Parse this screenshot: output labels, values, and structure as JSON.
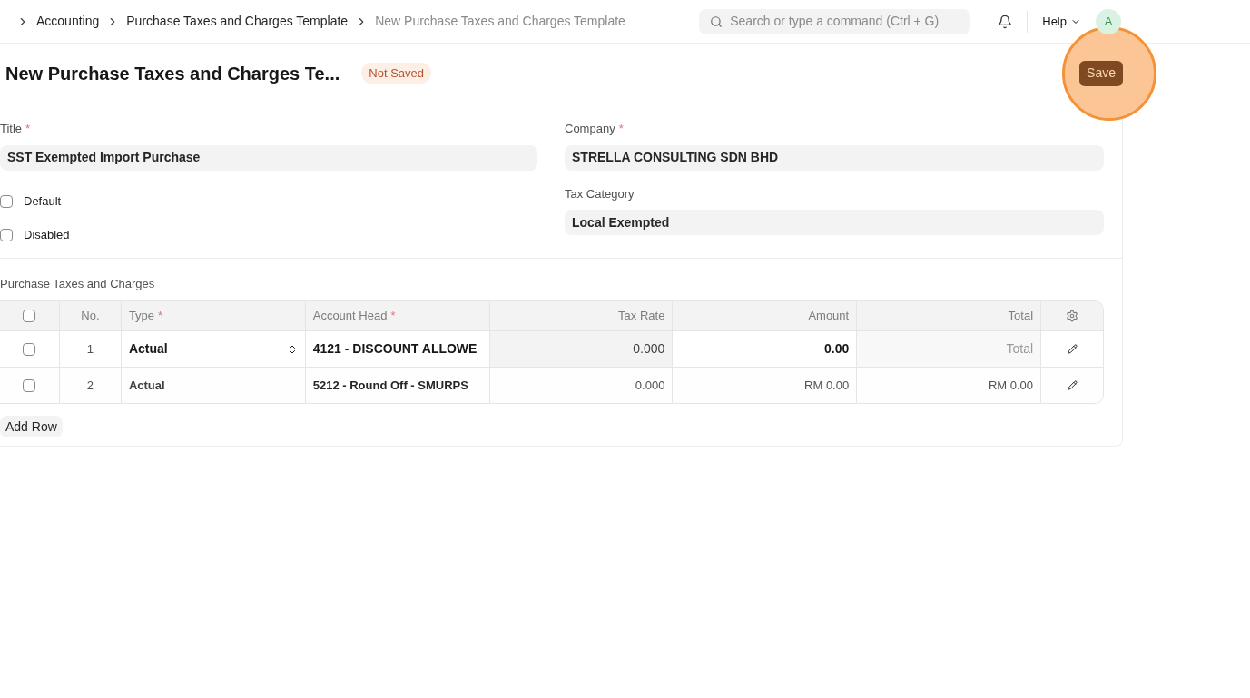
{
  "breadcrumbs": [
    {
      "label": "Accounting",
      "current": false
    },
    {
      "label": "Purchase Taxes and Charges Template",
      "current": false
    },
    {
      "label": "New Purchase Taxes and Charges Template",
      "current": true
    }
  ],
  "search": {
    "placeholder": "Search or type a command (Ctrl + G)"
  },
  "help": "Help",
  "avatar": "A",
  "page": {
    "title": "New Purchase Taxes and Charges Te...",
    "status": "Not Saved",
    "save": "Save",
    "highlight_save": true
  },
  "fields_left": [
    {
      "kind": "text",
      "label": "Title",
      "required_mark": "*",
      "value": "SST Exempted Import Purchase"
    },
    {
      "kind": "checkbox",
      "label": "Default",
      "checked": false
    },
    {
      "kind": "checkbox",
      "label": "Disabled",
      "checked": false
    }
  ],
  "fields_right": [
    {
      "kind": "text",
      "label": "Company",
      "required_mark": "*",
      "value": "STRELLA CONSULTING SDN BHD"
    },
    {
      "kind": "text",
      "label": "Tax Category",
      "value": "Local Exempted"
    }
  ],
  "table": {
    "label": "Purchase Taxes and Charges",
    "select_all": {
      "checked": false
    },
    "columns": [
      {
        "label": "No."
      },
      {
        "label": "Type",
        "required_mark": "*"
      },
      {
        "label": "Account Head",
        "required_mark": "*"
      },
      {
        "label": "Tax Rate"
      },
      {
        "label": "Amount"
      },
      {
        "label": "Total"
      }
    ],
    "rows": [
      {
        "checked": false,
        "editing": true,
        "no": "1",
        "type": "Actual",
        "account_head": "4121 - DISCOUNT ALLOWE",
        "tax_rate": "0.000",
        "amount": "0.00",
        "total_placeholder": "Total"
      },
      {
        "checked": false,
        "editing": false,
        "no": "2",
        "type": "Actual",
        "account_head": "5212 - Round Off - SMURPS",
        "tax_rate": "0.000",
        "amount": "RM 0.00",
        "total": "RM 0.00"
      }
    ],
    "add_row": "Add Row"
  }
}
